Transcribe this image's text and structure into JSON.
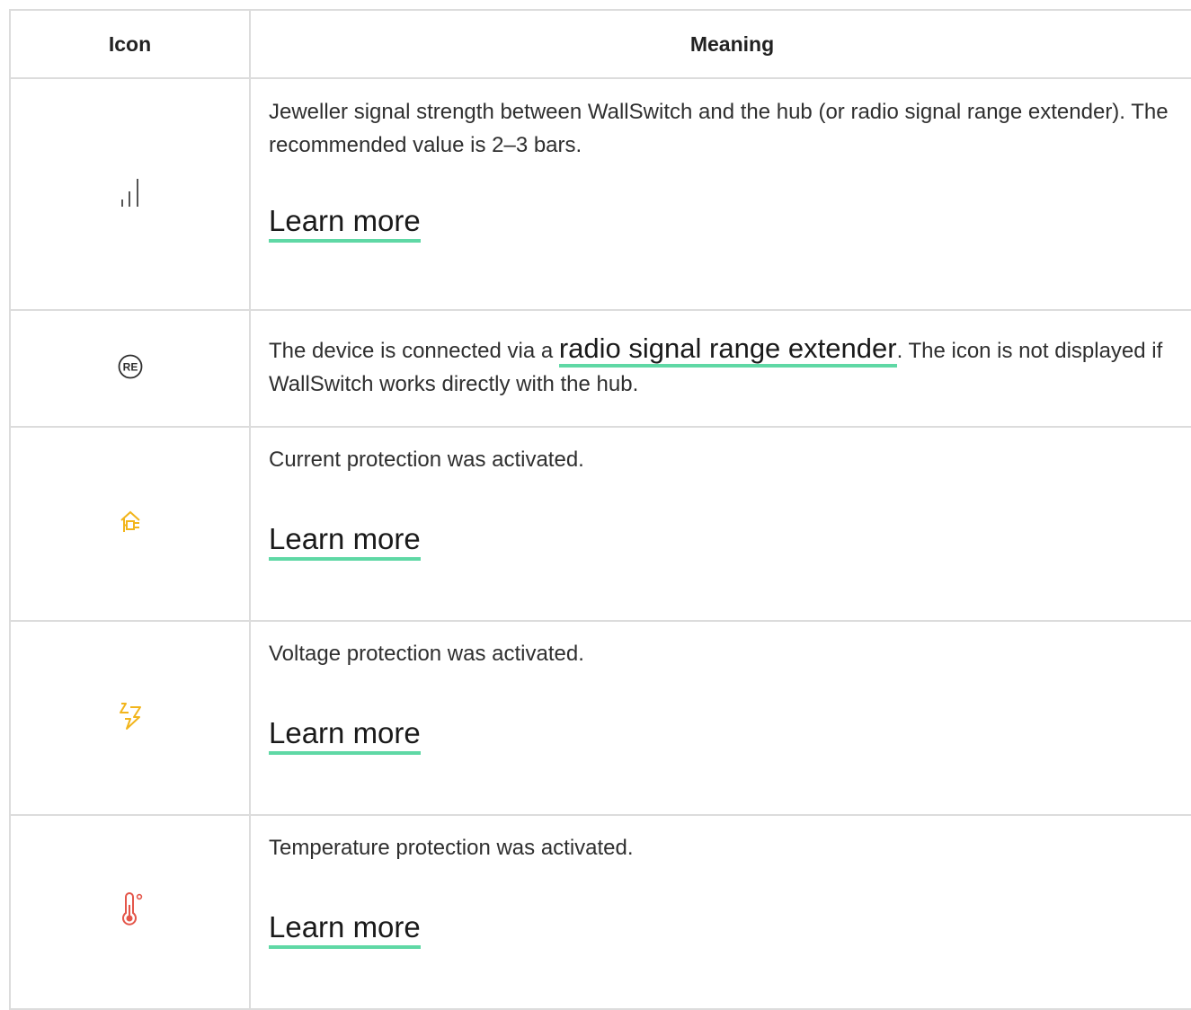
{
  "table": {
    "headers": {
      "icon": "Icon",
      "meaning": "Meaning"
    },
    "rows": [
      {
        "icon": "signal-strength-icon",
        "text": "Jeweller signal strength between WallSwitch and the hub (or radio signal range extender). The recommended value is 2–3 bars.",
        "link": "Learn more"
      },
      {
        "icon": "range-extender-icon",
        "text_before": "The device is connected via a ",
        "link": "radio signal range extender",
        "text_after": ". The icon is not displayed if WallSwitch works directly with the hub."
      },
      {
        "icon": "current-protection-icon",
        "text": "Current protection was activated.",
        "link": "Learn more"
      },
      {
        "icon": "voltage-protection-icon",
        "text": "Voltage protection was activated.",
        "link": "Learn more"
      },
      {
        "icon": "temperature-protection-icon",
        "text": "Temperature protection was activated.",
        "link": "Learn more"
      }
    ]
  },
  "colors": {
    "border": "#dcdcdc",
    "link_underline": "#5fd8a5",
    "warning_icon": "#f2b51c",
    "temperature_icon": "#e4564a",
    "neutral_icon": "#555555"
  }
}
